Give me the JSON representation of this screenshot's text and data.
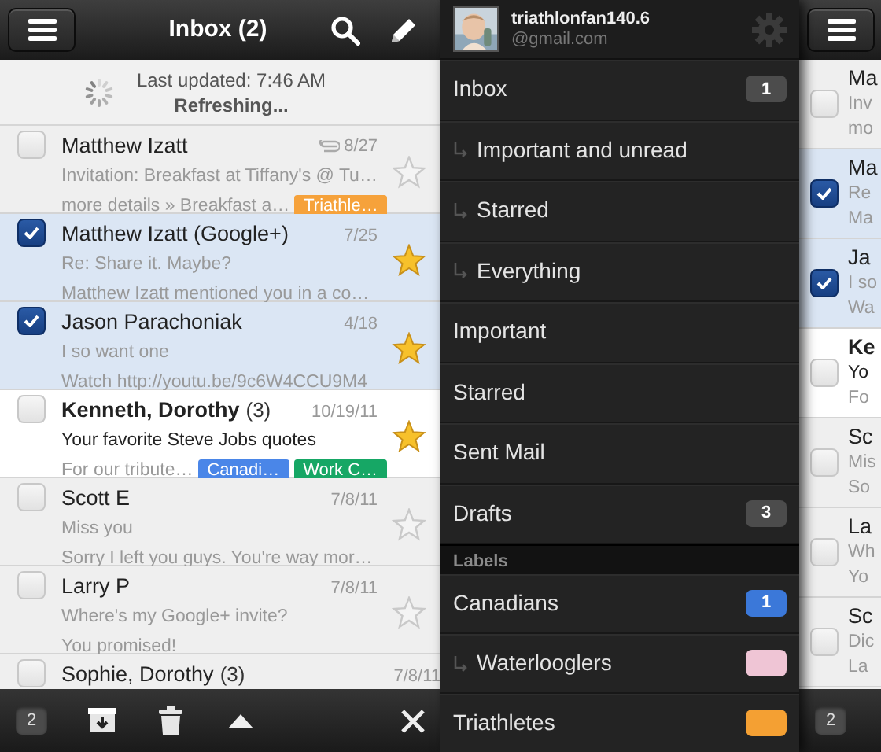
{
  "inbox": {
    "toolbar": {
      "title": "Inbox (2)"
    },
    "refresh": {
      "updated": "Last updated: 7:46 AM",
      "status": "Refreshing..."
    },
    "rows": [
      {
        "sender": "Matthew Izatt",
        "date": "8/27",
        "attachment": true,
        "subject": "Invitation: Breakfast at Tiffany's @ Tu…",
        "snippet": "more details » Breakfast a…",
        "labels": [
          {
            "text": "Triathle…",
            "color": "#f6a23b"
          }
        ],
        "checked": false,
        "starred": false,
        "unread": false
      },
      {
        "sender": "Matthew Izatt (Google+)",
        "date": "7/25",
        "attachment": false,
        "subject": "Re: Share it. Maybe?",
        "snippet": "Matthew Izatt mentioned you in a co…",
        "checked": true,
        "starred": true,
        "unread": false
      },
      {
        "sender": "Jason Parachoniak",
        "date": "4/18",
        "attachment": false,
        "subject": "I so want one",
        "snippet": "Watch http://youtu.be/9c6W4CCU9M4",
        "checked": true,
        "starred": true,
        "unread": false
      },
      {
        "sender": "Kenneth, Dorothy",
        "count": "(3)",
        "date": "10/19/11",
        "attachment": false,
        "subject": "Your favorite Steve Jobs quotes",
        "snippet": "For our tribute…",
        "labels": [
          {
            "text": "Canadi…",
            "color": "#4a86e8"
          },
          {
            "text": "Work C…",
            "color": "#16a765"
          }
        ],
        "checked": false,
        "starred": true,
        "unread": true
      },
      {
        "sender": "Scott E",
        "date": "7/8/11",
        "attachment": false,
        "subject": "Miss you",
        "snippet": "Sorry I left you guys. You're way mor…",
        "checked": false,
        "starred": false,
        "unread": false
      },
      {
        "sender": "Larry P",
        "date": "7/8/11",
        "attachment": false,
        "subject": "Where's my Google+ invite?",
        "snippet": "You promised!",
        "checked": false,
        "starred": false,
        "unread": false
      },
      {
        "sender": "Sophie, Dorothy",
        "count": "(3)",
        "date": "7/8/11",
        "checked": false,
        "unread": false
      }
    ],
    "action_bar": {
      "selected_count": "2"
    }
  },
  "drawer": {
    "account": {
      "name": "triathlonfan140.6",
      "domain": "@gmail.com"
    },
    "items": [
      {
        "kind": "folder",
        "label": "Inbox",
        "count": "1",
        "children": [
          {
            "kind": "folder",
            "label": "Important and unread"
          },
          {
            "kind": "folder",
            "label": "Starred"
          },
          {
            "kind": "folder",
            "label": "Everything"
          }
        ]
      },
      {
        "kind": "folder",
        "label": "Important"
      },
      {
        "kind": "folder",
        "label": "Starred"
      },
      {
        "kind": "folder",
        "label": "Sent Mail"
      },
      {
        "kind": "folder",
        "label": "Drafts",
        "count": "3"
      },
      {
        "kind": "section",
        "label": "Labels"
      },
      {
        "kind": "label",
        "label": "Canadians",
        "count": "1",
        "color": "#3b78d9",
        "children": [
          {
            "kind": "label",
            "label": "Waterlooglers",
            "color": "#efc5d5"
          }
        ]
      },
      {
        "kind": "label",
        "label": "Triathletes",
        "color": "#f4a033"
      }
    ]
  },
  "peek": {
    "rows": [
      {
        "sender": "Ma",
        "subject": "Inv",
        "snippet": "mo",
        "checked": false,
        "unread": false
      },
      {
        "sender": "Ma",
        "subject": "Re",
        "snippet": "Ma",
        "checked": true,
        "unread": false
      },
      {
        "sender": "Ja",
        "subject": "I so",
        "snippet": "Wa",
        "checked": true,
        "unread": false
      },
      {
        "sender": "Ke",
        "subject": "Yo",
        "snippet": "Fo",
        "checked": false,
        "unread": true
      },
      {
        "sender": "Sc",
        "subject": "Mis",
        "snippet": "So",
        "checked": false,
        "unread": false
      },
      {
        "sender": "La",
        "subject": "Wh",
        "snippet": "Yo",
        "checked": false,
        "unread": false
      },
      {
        "sender": "Sc",
        "subject": "Dic",
        "snippet": "La",
        "checked": false,
        "unread": false
      }
    ],
    "action_bar": {
      "selected_count": "2"
    }
  }
}
